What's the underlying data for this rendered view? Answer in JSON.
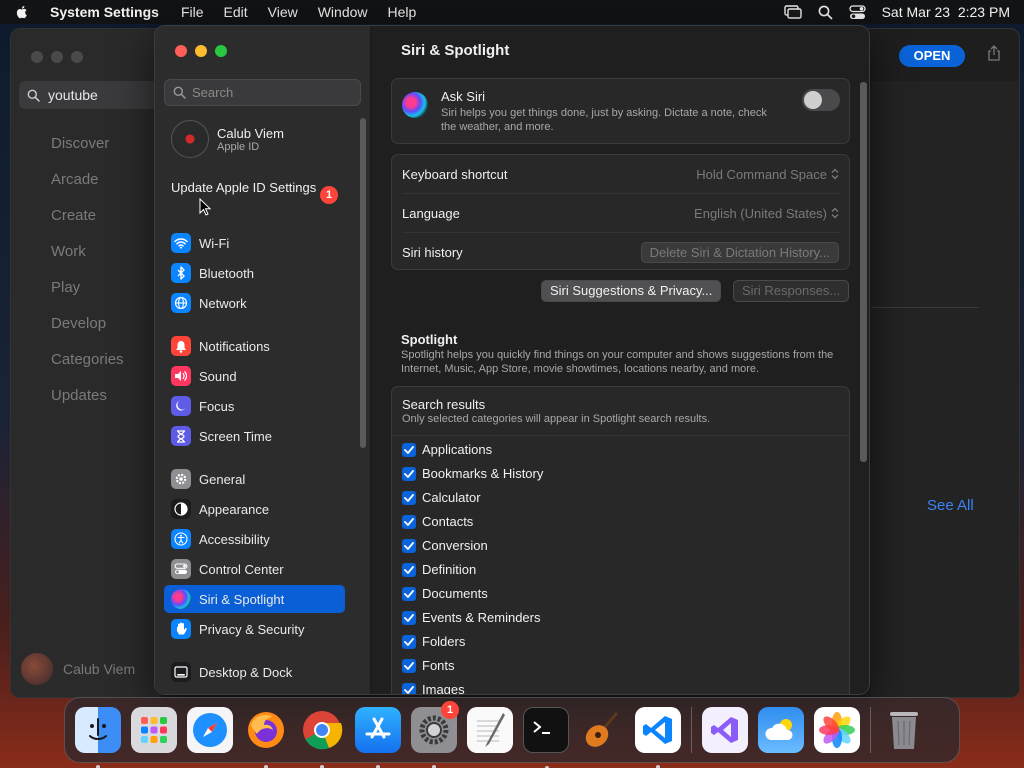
{
  "menubar": {
    "app_name": "System Settings",
    "menus": [
      "File",
      "Edit",
      "View",
      "Window",
      "Help"
    ],
    "datetime": "Sat Mar 23  2:23 PM"
  },
  "app_store": {
    "search_value": "youtube",
    "nav": [
      "Discover",
      "Arcade",
      "Create",
      "Work",
      "Play",
      "Develop",
      "Categories",
      "Updates"
    ],
    "user_name": "Calub Viem",
    "open_label": "OPEN",
    "see_all_label": "See All"
  },
  "settings": {
    "search_placeholder": "Search",
    "profile": {
      "name": "Calub Viem",
      "subtitle": "Apple ID"
    },
    "update_label": "Update Apple ID Settings",
    "update_badge": "1",
    "sidebar": [
      {
        "label": "Wi-Fi",
        "icon": "wifi-icon",
        "color": "#0a84ff"
      },
      {
        "label": "Bluetooth",
        "icon": "bluetooth-icon",
        "color": "#0a84ff"
      },
      {
        "label": "Network",
        "icon": "globe-icon",
        "color": "#0a84ff"
      },
      {
        "label": "Notifications",
        "icon": "bell-icon",
        "color": "#ff453a"
      },
      {
        "label": "Sound",
        "icon": "speaker-icon",
        "color": "#ff375f"
      },
      {
        "label": "Focus",
        "icon": "moon-icon",
        "color": "#5e5ce6"
      },
      {
        "label": "Screen Time",
        "icon": "hourglass-icon",
        "color": "#5e5ce6"
      },
      {
        "label": "General",
        "icon": "gear-icon",
        "color": "#8e8e93"
      },
      {
        "label": "Appearance",
        "icon": "appearance-icon",
        "color": "#1c1c1e"
      },
      {
        "label": "Accessibility",
        "icon": "accessibility-icon",
        "color": "#0a84ff"
      },
      {
        "label": "Control Center",
        "icon": "control-center-icon",
        "color": "#8e8e93"
      },
      {
        "label": "Siri & Spotlight",
        "icon": "siri-icon",
        "color": "#1c1c1e"
      },
      {
        "label": "Privacy & Security",
        "icon": "hand-icon",
        "color": "#0a84ff"
      },
      {
        "label": "Desktop & Dock",
        "icon": "dock-icon",
        "color": "#1c1c1e"
      }
    ],
    "content": {
      "title": "Siri & Spotlight",
      "ask_siri_title": "Ask Siri",
      "ask_siri_desc": "Siri helps you get things done, just by asking. Dictate a note, check the weather, and more.",
      "rows": [
        {
          "label": "Keyboard shortcut",
          "value": "Hold Command Space"
        },
        {
          "label": "Language",
          "value": "English (United States)"
        },
        {
          "label": "Siri history",
          "button": "Delete Siri & Dictation History..."
        }
      ],
      "privacy_button": "Siri Suggestions & Privacy...",
      "responses_button": "Siri Responses...",
      "spotlight_title": "Spotlight",
      "spotlight_desc": "Spotlight helps you quickly find things on your computer and shows suggestions from the Internet, Music, App Store, movie showtimes, locations nearby, and more.",
      "results_title": "Search results",
      "results_sub": "Only selected categories will appear in Spotlight search results.",
      "categories": [
        "Applications",
        "Bookmarks & History",
        "Calculator",
        "Contacts",
        "Conversion",
        "Definition",
        "Documents",
        "Events & Reminders",
        "Folders",
        "Fonts",
        "Images"
      ]
    }
  },
  "dock": {
    "settings_badge": "1"
  }
}
